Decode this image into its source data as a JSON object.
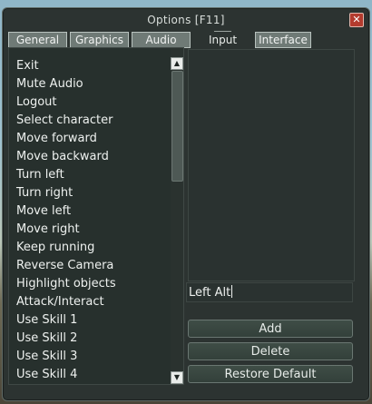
{
  "window": {
    "title": "Options  [F11]",
    "close_glyph": "✕"
  },
  "tabs": [
    {
      "label": "General",
      "active": false
    },
    {
      "label": "Graphics",
      "active": false
    },
    {
      "label": "Audio",
      "active": false
    },
    {
      "label": "Input",
      "active": true
    },
    {
      "label": "Interface",
      "active": false
    }
  ],
  "actions_list": {
    "items": [
      "Exit",
      "Mute Audio",
      "Logout",
      "Select character",
      "Move forward",
      "Move backward",
      "Turn left",
      "Turn right",
      "Move left",
      "Move right",
      "Keep running",
      "Reverse Camera",
      "Highlight objects",
      "Attack/Interact",
      "Use Skill 1",
      "Use Skill 2",
      "Use Skill 3",
      "Use Skill 4"
    ],
    "scroll_up_glyph": "▲",
    "scroll_down_glyph": "▼"
  },
  "binding": {
    "key_value": "Left Alt"
  },
  "buttons": {
    "add": "Add",
    "delete": "Delete",
    "restore": "Restore Default"
  },
  "colors": {
    "window_bg": "#2c3331",
    "tab_bg": "#6f7a76",
    "close_red": "#b33b2e",
    "button_green": "#3f4d46"
  }
}
